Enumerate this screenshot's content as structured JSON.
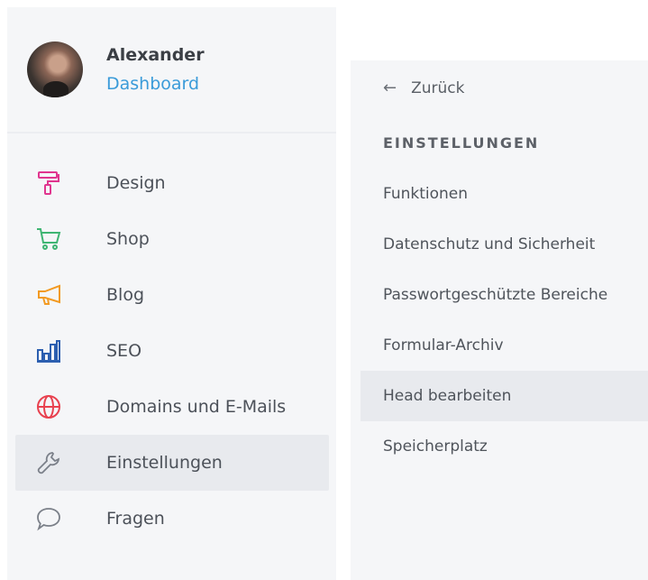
{
  "profile": {
    "name": "Alexander",
    "link": "Dashboard"
  },
  "nav": {
    "items": [
      {
        "label": "Design",
        "icon": "paint-roller-icon",
        "color": "#e0368f"
      },
      {
        "label": "Shop",
        "icon": "shopping-cart-icon",
        "color": "#3fb573"
      },
      {
        "label": "Blog",
        "icon": "megaphone-icon",
        "color": "#f29a22"
      },
      {
        "label": "SEO",
        "icon": "bar-chart-icon",
        "color": "#2c5fb0"
      },
      {
        "label": "Domains und E-Mails",
        "icon": "globe-icon",
        "color": "#e8414f"
      },
      {
        "label": "Einstellungen",
        "icon": "wrench-icon",
        "color": "#7b8089",
        "active": true
      },
      {
        "label": "Fragen",
        "icon": "speech-bubble-icon",
        "color": "#7b8089"
      }
    ]
  },
  "panel": {
    "back_label": "Zurück",
    "back_arrow": "←",
    "heading": "EINSTELLUNGEN",
    "items": [
      {
        "label": "Funktionen"
      },
      {
        "label": "Datenschutz und Sicherheit"
      },
      {
        "label": "Passwortgeschützte Bereiche"
      },
      {
        "label": "Formular-Archiv"
      },
      {
        "label": "Head bearbeiten",
        "active": true
      },
      {
        "label": "Speicherplatz"
      }
    ]
  }
}
